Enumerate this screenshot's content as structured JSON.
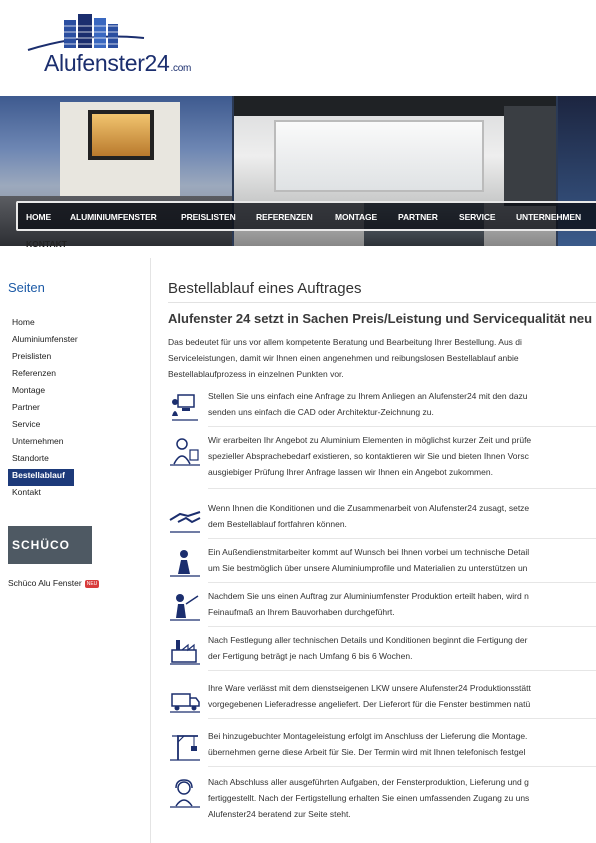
{
  "logo": {
    "name": "Alufenster24",
    "suffix": ".com"
  },
  "nav": {
    "items": [
      "HOME",
      "ALUMINIUMFENSTER",
      "PREISLISTEN",
      "REFERENZEN",
      "MONTAGE",
      "PARTNER",
      "SERVICE",
      "UNTERNEHMEN"
    ],
    "kontakt": "KONTAKT"
  },
  "sidebar": {
    "title": "Seiten",
    "items": [
      "Home",
      "Aluminiumfenster",
      "Preislisten",
      "Referenzen",
      "Montage",
      "Partner",
      "Service",
      "Unternehmen",
      "Standorte",
      "Bestellablauf",
      "Kontakt"
    ],
    "active": "Bestellablauf",
    "brand": "SCHÜCO",
    "brand_link": "Schüco Alu Fenster",
    "badge": "NEU"
  },
  "main": {
    "title": "Bestellablauf eines Auftrages",
    "subtitle": "Alufenster 24 setzt in Sachen Preis/Leistung und Servicequalität neu",
    "intro": [
      "Das bedeutet für uns vor allem kompetente Beratung und Bearbeitung Ihrer Bestellung. Aus di",
      "Serviceleistungen, damit wir Ihnen einen angenehmen und reibungslosen Bestellablauf anbie",
      "Bestellablaufprozess in einzelnen Punkten vor."
    ],
    "steps": [
      {
        "icon": "computer-icon",
        "lines": [
          "Stellen Sie uns einfach eine Anfrage zu Ihrem Anliegen an Alufenster24 mit den dazu",
          "senden uns einfach die CAD oder Architektur-Zeichnung zu."
        ]
      },
      {
        "icon": "consultant-icon",
        "lines": [
          "Wir erarbeiten Ihr Angebot zu Aluminium Elementen in möglichst kurzer Zeit und prüfe",
          "spezieller Absprachebedarf existieren, so kontaktieren wir Sie und bieten Ihnen Vorsc",
          "ausgiebiger Prüfung Ihrer Anfrage lassen wir Ihnen ein Angebot zukommen."
        ]
      },
      {
        "icon": "handshake-icon",
        "lines": [
          "Wenn Ihnen die Konditionen und die Zusammenarbeit von Alufenster24 zusagt, setze",
          "dem Bestellablauf fortfahren können."
        ]
      },
      {
        "icon": "field-agent-icon",
        "lines": [
          "Ein Außendienstmitarbeiter kommt auf Wunsch bei Ihnen vorbei um technische Detail",
          "um Sie bestmöglich über unsere Aluminiumprofile und Materialien zu unterstützen un"
        ]
      },
      {
        "icon": "measuring-icon",
        "lines": [
          "Nachdem Sie uns einen Auftrag zur Aluminiumfenster Produktion erteilt haben, wird n",
          "Feinaufmaß an Ihrem Bauvorhaben durchgeführt."
        ]
      },
      {
        "icon": "factory-icon",
        "lines": [
          "Nach Festlegung aller technischen Details und Konditionen beginnt die Fertigung der",
          "der Fertigung beträgt je nach Umfang 6 bis 6 Wochen."
        ]
      },
      {
        "icon": "truck-icon",
        "lines": [
          "Ihre Ware verlässt mit dem dienstseigenen LKW unsere Alufenster24 Produktionsstätt",
          "vorgegebenen Lieferadresse angeliefert. Der Lieferort für die Fenster bestimmen natü"
        ]
      },
      {
        "icon": "crane-icon",
        "lines": [
          "Bei hinzugebuchter Montageleistung erfolgt im Anschluss der Lieferung die Montage.",
          "übernehmen gerne diese Arbeit für Sie. Der Termin wird mit Ihnen telefonisch festgel"
        ]
      },
      {
        "icon": "support-icon",
        "lines": [
          "Nach Abschluss aller ausgeführten Aufgaben, der Fensterproduktion, Lieferung und g",
          "fertiggestellt. Nach der Fertigstellung erhalten Sie einen umfassenden Zugang zu uns",
          "Alufenster24 beratend zur Seite steht."
        ]
      }
    ]
  },
  "colors": {
    "brand_blue": "#1b2e6e",
    "accent_blue": "#1c5aa6",
    "active_bg": "#1d3a7a",
    "nav_bg": "#0c0e14"
  }
}
